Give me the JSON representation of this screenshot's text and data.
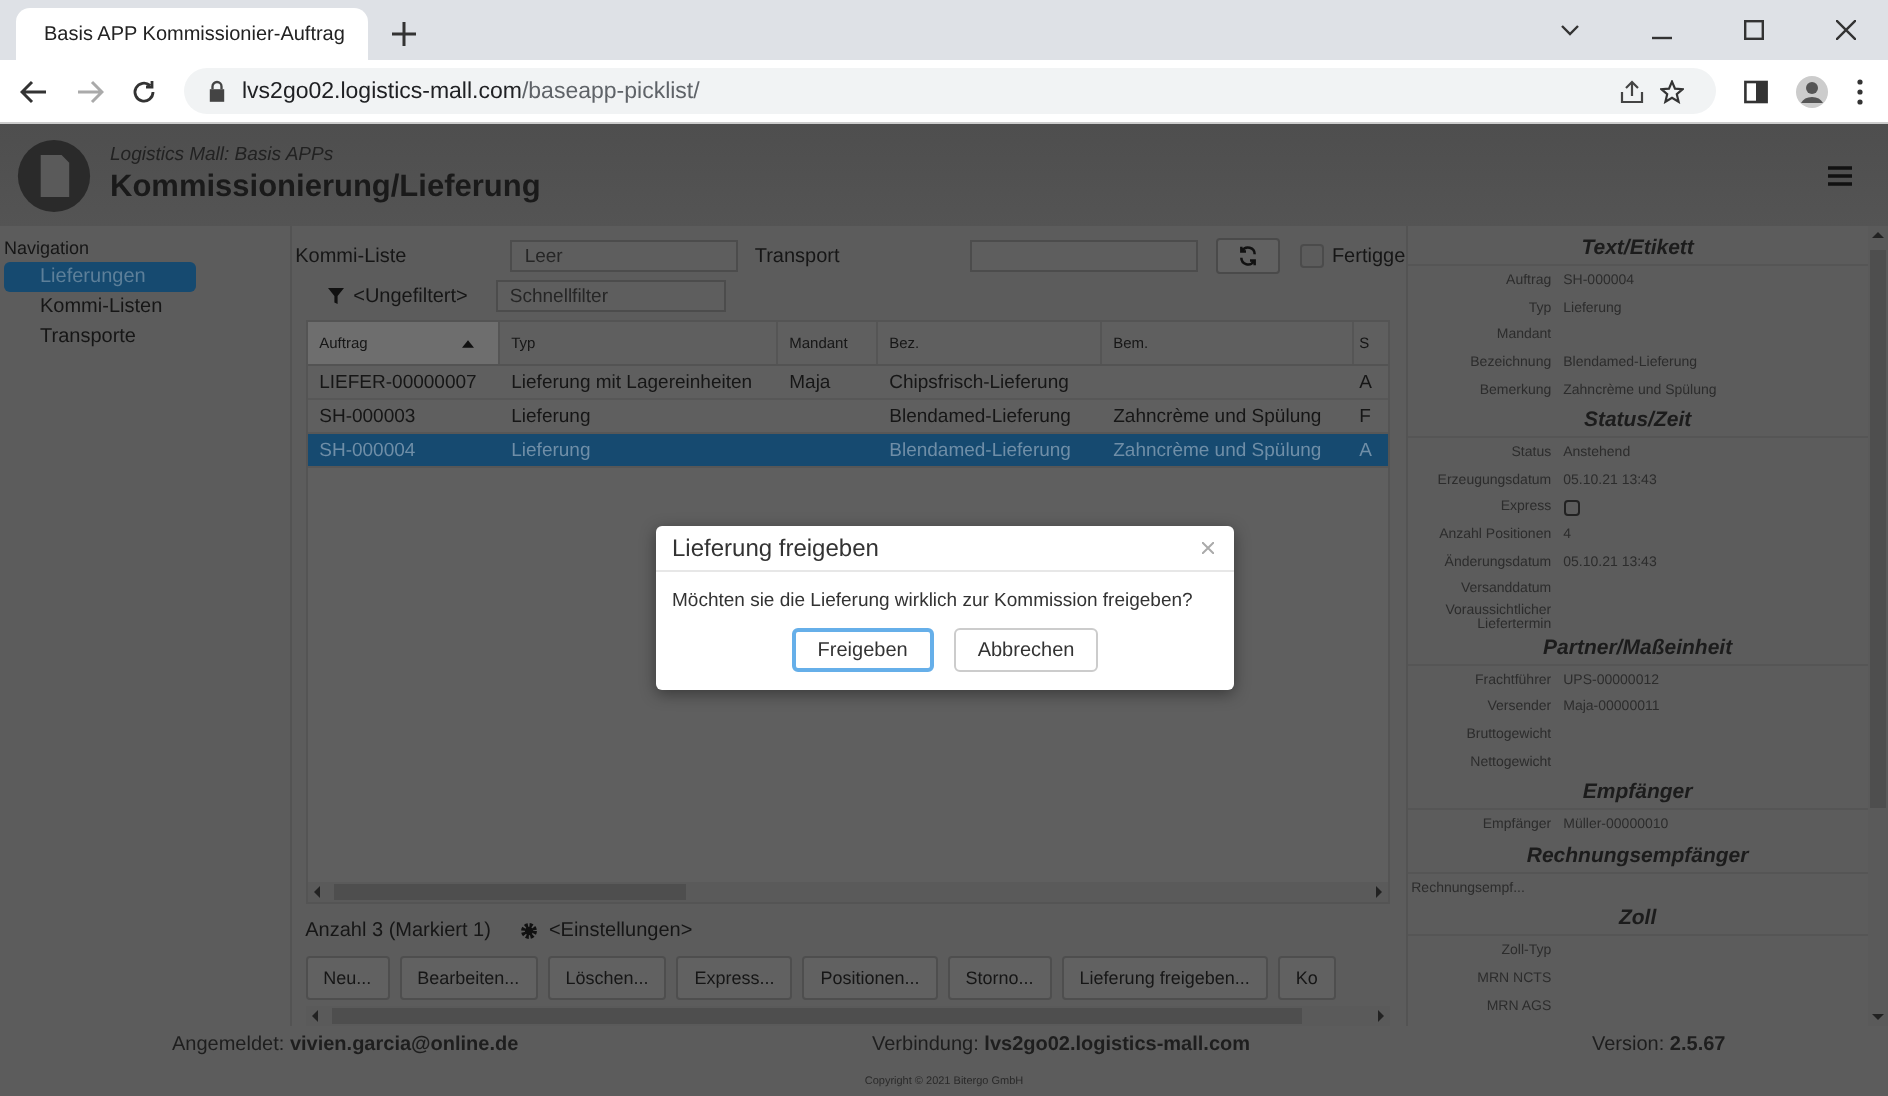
{
  "browser": {
    "tab_title": "Basis APP Kommissionier-Auftrag",
    "url_host": "lvs2go02.logistics-mall.com",
    "url_path": "/baseapp-picklist/"
  },
  "header": {
    "subtitle": "Logistics Mall: Basis APPs",
    "title": "Kommissionierung/Lieferung"
  },
  "navigation": {
    "title": "Navigation",
    "items": [
      {
        "label": "Lieferungen",
        "selected": true
      },
      {
        "label": "Kommi-Listen",
        "selected": false
      },
      {
        "label": "Transporte",
        "selected": false
      }
    ]
  },
  "filters": {
    "kommi_liste_label": "Kommi-Liste",
    "kommi_liste_placeholder": "Leer",
    "transport_label": "Transport",
    "fertig_label": "Fertigge",
    "fertig_checked": false,
    "filter_label": "<Ungefiltert>",
    "quickfilter_placeholder": "Schnellfilter"
  },
  "table": {
    "columns": [
      {
        "label": "Auftrag",
        "sorted": true
      },
      {
        "label": "Typ",
        "sorted": false
      },
      {
        "label": "Mandant",
        "sorted": false
      },
      {
        "label": "Bez.",
        "sorted": false
      },
      {
        "label": "Bem.",
        "sorted": false
      },
      {
        "label": "S",
        "sorted": false
      }
    ],
    "rows": [
      {
        "cells": [
          "LIEFER-00000007",
          "Lieferung mit Lagereinheiten",
          "Maja",
          "Chipsfrisch-Lieferung",
          "",
          "A"
        ],
        "selected": false
      },
      {
        "cells": [
          "SH-000003",
          "Lieferung",
          "",
          "Blendamed-Lieferung",
          "Zahncrème und Spülung",
          "F"
        ],
        "selected": false
      },
      {
        "cells": [
          "SH-000004",
          "Lieferung",
          "",
          "Blendamed-Lieferung",
          "Zahncrème und Spülung",
          "A"
        ],
        "selected": true
      }
    ]
  },
  "summary": "Anzahl 3 (Markiert 1)",
  "settings_link": "<Einstellungen>",
  "actions": [
    "Neu...",
    "Bearbeiten...",
    "Löschen...",
    "Express...",
    "Positionen...",
    "Storno...",
    "Lieferung freigeben...",
    "Ko"
  ],
  "details": {
    "sections": [
      {
        "title": "Text/Etikett",
        "fields": [
          {
            "kind": "text",
            "label": "Auftrag",
            "value": "SH-000004"
          },
          {
            "kind": "text",
            "label": "Typ",
            "value": "Lieferung"
          },
          {
            "kind": "text",
            "label": "Mandant"
          },
          {
            "kind": "text",
            "label": "Bezeichnung",
            "value": "Blendamed-Lieferung"
          },
          {
            "kind": "text",
            "label": "Bemerkung",
            "value": "Zahncrème und Spülung"
          }
        ]
      },
      {
        "title": "Status/Zeit",
        "fields": [
          {
            "kind": "text",
            "label": "Status",
            "value": "Anstehend"
          },
          {
            "kind": "text",
            "label": "Erzeugungsdatum",
            "value": "05.10.21 13:43"
          },
          {
            "kind": "checkbox",
            "label": "Express",
            "checked": false
          },
          {
            "kind": "text",
            "label": "Anzahl Positionen",
            "value": "4"
          },
          {
            "kind": "text",
            "label": "Änderungsdatum",
            "value": "05.10.21 13:43"
          },
          {
            "kind": "text",
            "label": "Versanddatum"
          },
          {
            "kind": "text",
            "label": "Voraussichtlicher Liefertermin"
          }
        ]
      },
      {
        "title": "Partner/Maßeinheit",
        "fields": [
          {
            "kind": "text",
            "label": "Frachtführer",
            "value": "UPS-00000012"
          },
          {
            "kind": "text",
            "label": "Versender",
            "value": "Maja-00000011"
          },
          {
            "kind": "text",
            "label": "Bruttogewicht"
          },
          {
            "kind": "text",
            "label": "Nettogewicht"
          }
        ]
      },
      {
        "title": "Empfänger",
        "fields": [
          {
            "kind": "text",
            "label": "Empfänger",
            "value": "Müller-00000010"
          }
        ]
      },
      {
        "title": "Rechnungsempfänger",
        "fields": [
          {
            "kind": "note",
            "label": "Rechnungsempf..."
          }
        ]
      },
      {
        "title": "Zoll",
        "fields": [
          {
            "kind": "text",
            "label": "Zoll-Typ"
          },
          {
            "kind": "text",
            "label": "MRN NCTS"
          },
          {
            "kind": "text",
            "label": "MRN AGS"
          }
        ]
      }
    ]
  },
  "footer": {
    "login_label": "Angemeldet:",
    "login_user": "vivien.garcia@online.de",
    "connection_label": "Verbindung:",
    "connection_host": "lvs2go02.logistics-mall.com",
    "version_label": "Version:",
    "version": "2.5.67",
    "copyright": "Copyright © 2021 Bitergo GmbH"
  },
  "dialog": {
    "title": "Lieferung freigeben",
    "message": "Möchten sie die Lieferung wirklich zur Kommission freigeben?",
    "buttons": [
      {
        "label": "Freigeben",
        "focused": true
      },
      {
        "label": "Abbrechen",
        "focused": false
      }
    ]
  }
}
